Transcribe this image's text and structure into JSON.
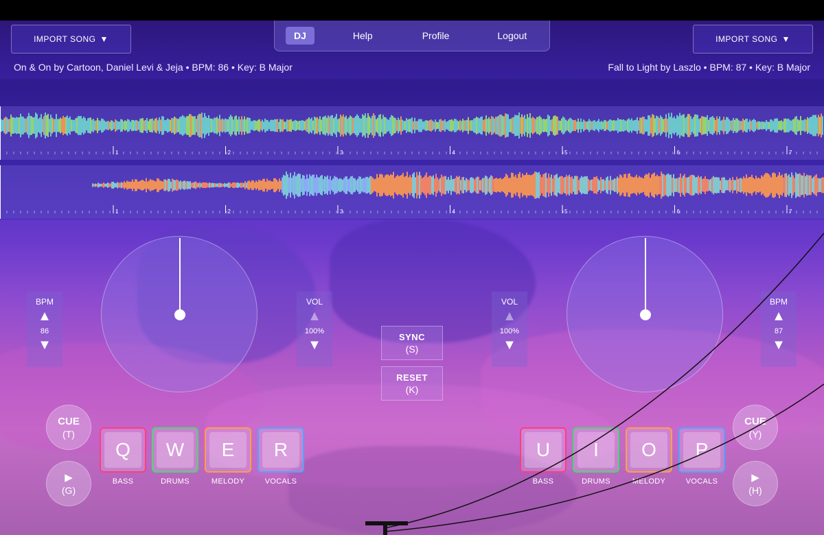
{
  "colors": {
    "bass": "#ff3d7f",
    "drums": "#3ee06a",
    "melody": "#ffa040",
    "vocals": "#4aa8ff"
  },
  "header": {
    "import_left": "IMPORT SONG",
    "import_right": "IMPORT SONG",
    "dropdown_glyph": "▼",
    "nav": {
      "dj": "DJ",
      "help": "Help",
      "profile": "Profile",
      "logout": "Logout"
    }
  },
  "decks": {
    "left": {
      "song_info": "On & On by Cartoon, Daniel Levi & Jeja • BPM: 86 • Key: B Major",
      "bpm_label": "BPM",
      "bpm_value": "86",
      "vol_label": "VOL",
      "vol_value": "100%",
      "cue_label": "CUE",
      "cue_key": "(T)",
      "play_glyph": "▶",
      "play_key": "(G)",
      "pads": [
        {
          "key": "Q",
          "label": "BASS"
        },
        {
          "key": "W",
          "label": "DRUMS"
        },
        {
          "key": "E",
          "label": "MELODY"
        },
        {
          "key": "R",
          "label": "VOCALS"
        }
      ]
    },
    "right": {
      "song_info": "Fall to Light by Laszlo • BPM: 87 • Key: B Major",
      "bpm_label": "BPM",
      "bpm_value": "87",
      "vol_label": "VOL",
      "vol_value": "100%",
      "cue_label": "CUE",
      "cue_key": "(Y)",
      "play_glyph": "▶",
      "play_key": "(H)",
      "pads": [
        {
          "key": "U",
          "label": "BASS"
        },
        {
          "key": "I",
          "label": "DRUMS"
        },
        {
          "key": "O",
          "label": "MELODY"
        },
        {
          "key": "P",
          "label": "VOCALS"
        }
      ]
    }
  },
  "center": {
    "sync_label": "SYNC",
    "sync_key": "(S)",
    "reset_label": "RESET",
    "reset_key": "(K)"
  },
  "timeline": {
    "bar_numbers": [
      "1",
      "2",
      "3",
      "4",
      "5",
      "6",
      "7"
    ]
  }
}
